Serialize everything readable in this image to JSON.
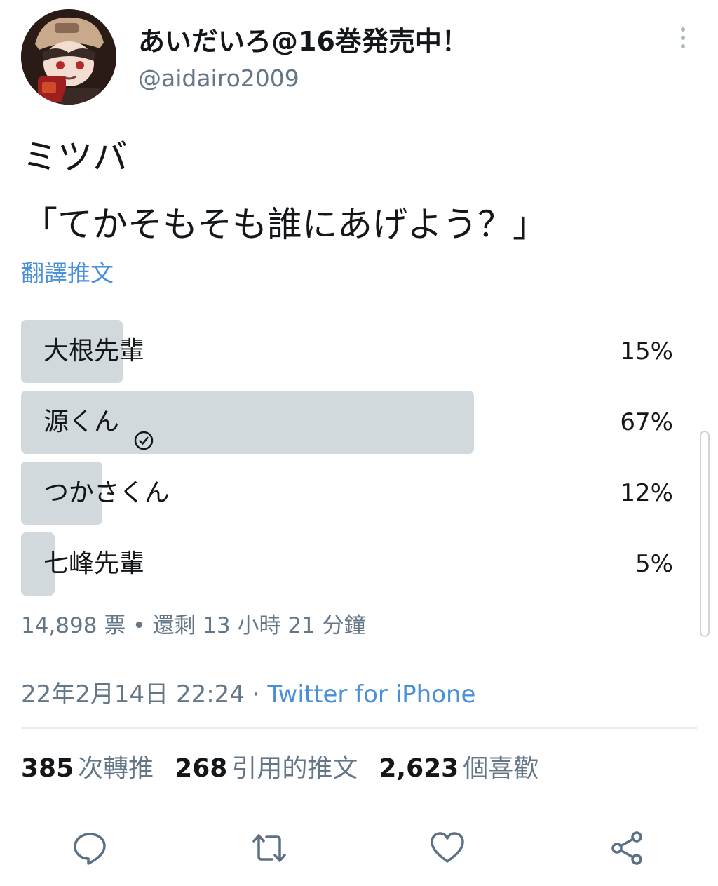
{
  "user": {
    "display_name": "あいだいろ@16巻発売中！",
    "handle": "@aidairo2009",
    "avatar_icon": "avatar-illustration"
  },
  "tweet": {
    "lines": [
      "ミツバ",
      "「てかそもそも誰にあげよう？」"
    ],
    "translate_label": "翻譯推文"
  },
  "poll": {
    "options": [
      {
        "label": "大根先輩",
        "percent_text": "15%",
        "fill_fraction": 0.15,
        "selected": false
      },
      {
        "label": "源くん",
        "percent_text": "67%",
        "fill_fraction": 0.67,
        "selected": true
      },
      {
        "label": "つかさくん",
        "percent_text": "12%",
        "fill_fraction": 0.12,
        "selected": false
      },
      {
        "label": "七峰先輩",
        "percent_text": "5%",
        "fill_fraction": 0.05,
        "selected": false
      }
    ],
    "meta": "14,898 票 • 還剩 13 小時 21 分鐘"
  },
  "timestamp": {
    "date": "22年2月14日 22:24",
    "separator": " · ",
    "source": "Twitter for iPhone"
  },
  "stats": {
    "retweets_num": "385",
    "retweets_label": "次轉推",
    "quotes_num": "268",
    "quotes_label": "引用的推文",
    "likes_num": "2,623",
    "likes_label": "個喜歡"
  },
  "colors": {
    "accent": "#4a90d6",
    "poll_fill": "#d2d9dd",
    "secondary_text": "#657786",
    "icon": "#5b7083"
  },
  "icons": [
    "more-vertical-icon",
    "check-circle-icon",
    "reply-icon",
    "retweet-icon",
    "like-icon",
    "share-icon"
  ]
}
